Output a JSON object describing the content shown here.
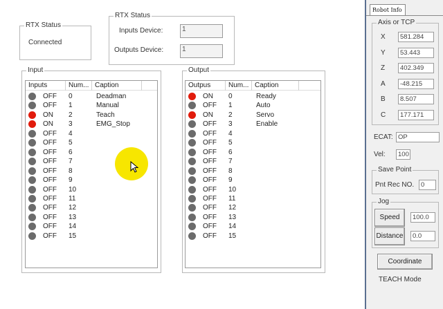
{
  "rtx_status_box": {
    "title": "RTX Status",
    "value": "Connected"
  },
  "rtx_status_devices": {
    "title": "RTX Status",
    "inputs_label": "Inputs Device:",
    "inputs_value": "1",
    "outputs_label": "Outputs Device:",
    "outputs_value": "1"
  },
  "input_panel": {
    "title": "Input",
    "headers": [
      "Inputs",
      "Num...",
      "Caption"
    ],
    "rows": [
      {
        "state": "OFF",
        "num": "0",
        "caption": "Deadman",
        "on": false
      },
      {
        "state": "OFF",
        "num": "1",
        "caption": "Manual",
        "on": false
      },
      {
        "state": "ON",
        "num": "2",
        "caption": "Teach",
        "on": true
      },
      {
        "state": "ON",
        "num": "3",
        "caption": "EMG_Stop",
        "on": true
      },
      {
        "state": "OFF",
        "num": "4",
        "caption": "",
        "on": false
      },
      {
        "state": "OFF",
        "num": "5",
        "caption": "",
        "on": false
      },
      {
        "state": "OFF",
        "num": "6",
        "caption": "",
        "on": false
      },
      {
        "state": "OFF",
        "num": "7",
        "caption": "",
        "on": false
      },
      {
        "state": "OFF",
        "num": "8",
        "caption": "",
        "on": false
      },
      {
        "state": "OFF",
        "num": "9",
        "caption": "",
        "on": false
      },
      {
        "state": "OFF",
        "num": "10",
        "caption": "",
        "on": false
      },
      {
        "state": "OFF",
        "num": "11",
        "caption": "",
        "on": false
      },
      {
        "state": "OFF",
        "num": "12",
        "caption": "",
        "on": false
      },
      {
        "state": "OFF",
        "num": "13",
        "caption": "",
        "on": false
      },
      {
        "state": "OFF",
        "num": "14",
        "caption": "",
        "on": false
      },
      {
        "state": "OFF",
        "num": "15",
        "caption": "",
        "on": false
      }
    ]
  },
  "output_panel": {
    "title": "Output",
    "headers": [
      "Outpus",
      "Num...",
      "Caption"
    ],
    "rows": [
      {
        "state": "ON",
        "num": "0",
        "caption": "Ready",
        "on": true
      },
      {
        "state": "OFF",
        "num": "1",
        "caption": "Auto",
        "on": false
      },
      {
        "state": "ON",
        "num": "2",
        "caption": "Servo",
        "on": true
      },
      {
        "state": "OFF",
        "num": "3",
        "caption": "Enable",
        "on": false
      },
      {
        "state": "OFF",
        "num": "4",
        "caption": "",
        "on": false
      },
      {
        "state": "OFF",
        "num": "5",
        "caption": "",
        "on": false
      },
      {
        "state": "OFF",
        "num": "6",
        "caption": "",
        "on": false
      },
      {
        "state": "OFF",
        "num": "7",
        "caption": "",
        "on": false
      },
      {
        "state": "OFF",
        "num": "8",
        "caption": "",
        "on": false
      },
      {
        "state": "OFF",
        "num": "9",
        "caption": "",
        "on": false
      },
      {
        "state": "OFF",
        "num": "10",
        "caption": "",
        "on": false
      },
      {
        "state": "OFF",
        "num": "11",
        "caption": "",
        "on": false
      },
      {
        "state": "OFF",
        "num": "12",
        "caption": "",
        "on": false
      },
      {
        "state": "OFF",
        "num": "13",
        "caption": "",
        "on": false
      },
      {
        "state": "OFF",
        "num": "14",
        "caption": "",
        "on": false
      },
      {
        "state": "OFF",
        "num": "15",
        "caption": "",
        "on": false
      }
    ]
  },
  "robot_info": {
    "tab_label": "Robot Info",
    "axis_title": "Axis or TCP",
    "axes": [
      {
        "label": "X",
        "value": "581.284"
      },
      {
        "label": "Y",
        "value": "53.443"
      },
      {
        "label": "Z",
        "value": "402.349"
      },
      {
        "label": "A",
        "value": "-48.215"
      },
      {
        "label": "B",
        "value": "8.507"
      },
      {
        "label": "C",
        "value": "177.171"
      }
    ],
    "ecat_label": "ECAT:",
    "ecat_value": "OP",
    "vel_label": "Vel:",
    "vel_value": "100",
    "save_point_title": "Save Point",
    "pnt_rec_label": "Pnt Rec NO.",
    "pnt_rec_value": "0",
    "jog_title": "Jog",
    "speed_label": "Speed",
    "speed_value": "100.0",
    "distance_label": "Distance",
    "distance_value": "0.0",
    "coordinate_label": "Coordinate",
    "mode_text": "TEACH Mode"
  },
  "colors": {
    "led_on": "#e11b0c",
    "led_off": "#6b6b6b",
    "cursor_highlight": "#f7e600",
    "panel_border": "#5a6f90"
  }
}
